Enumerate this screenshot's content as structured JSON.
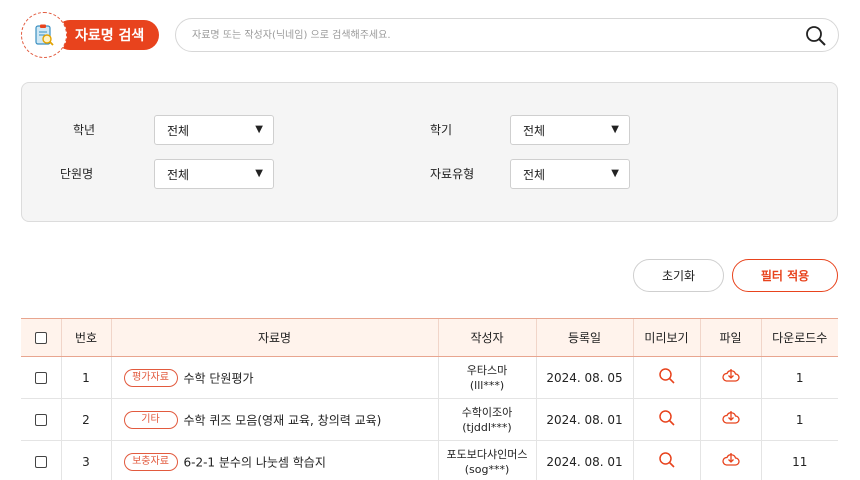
{
  "header": {
    "title": "자료명 검색",
    "search_placeholder": "자료명 또는 작성자(닉네임) 으로 검색해주세요."
  },
  "filters": {
    "grade": {
      "label": "학년",
      "value": "전체"
    },
    "semester": {
      "label": "학기",
      "value": "전체"
    },
    "unit": {
      "label": "단원명",
      "value": "전체"
    },
    "type": {
      "label": "자료유형",
      "value": "전체"
    }
  },
  "buttons": {
    "reset": "초기화",
    "apply": "필터 적용"
  },
  "table": {
    "headers": {
      "no": "번호",
      "name": "자료명",
      "author": "작성자",
      "date": "등록일",
      "preview": "미리보기",
      "file": "파일",
      "downloads": "다운로드수"
    },
    "rows": [
      {
        "no": "1",
        "tag": "평가자료",
        "title": "수학 단원평가",
        "author": "우타스마",
        "author_id": "(lll***)",
        "date": "2024. 08. 05",
        "downloads": "1"
      },
      {
        "no": "2",
        "tag": "기타",
        "title": "수학 퀴즈 모음(영재 교육, 창의력 교육)",
        "author": "수학이조아",
        "author_id": "(tjddl***)",
        "date": "2024. 08. 01",
        "downloads": "1"
      },
      {
        "no": "3",
        "tag": "보충자료",
        "title": "6-2-1 분수의 나눗셈 학습지",
        "author": "포도보다샤인머스",
        "author_id": "(sog***)",
        "date": "2024. 08. 01",
        "downloads": "11"
      }
    ]
  },
  "colors": {
    "accent": "#e8431d",
    "header_bg": "#fff3ec",
    "panel_bg": "#f5f5f5"
  },
  "icons": {
    "title": "clipboard-search-icon",
    "search": "search-icon",
    "preview": "magnifier-icon",
    "file": "cloud-download-icon"
  }
}
